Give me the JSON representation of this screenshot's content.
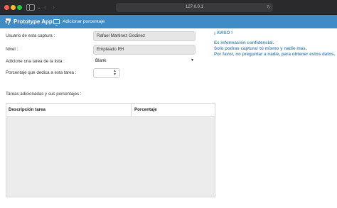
{
  "browser": {
    "url": "127.0.0.1"
  },
  "navbar": {
    "brand": "Prototype App",
    "add_label": "Adicionar porcentaje"
  },
  "form": {
    "user_label": "Usuario de esta captura :",
    "user_value": "Rafael Martinez Godinez",
    "level_label": "Nivel :",
    "level_value": "Empleado RH",
    "task_label": "Adicione una tarea de la lista :",
    "task_selected": "Blank",
    "percent_label": "Porcentaje que dedica a esta tarea :",
    "percent_value": ""
  },
  "alert": {
    "title": "¡ AVISO !",
    "line1": "Es información confidencial.",
    "line2": "Solo podras capturar tú mismo y nadie mas.",
    "line3": "Por favor, no preguntar a nadie, para obtener estos datos."
  },
  "table": {
    "caption": "Tareas adicionadas y sus porcentajes :",
    "columns": [
      "Descripción tarea",
      "Porcentaje"
    ],
    "rows": []
  },
  "colors": {
    "navbar": "#3f8bc6",
    "alert_text": "#3b8ed0"
  }
}
